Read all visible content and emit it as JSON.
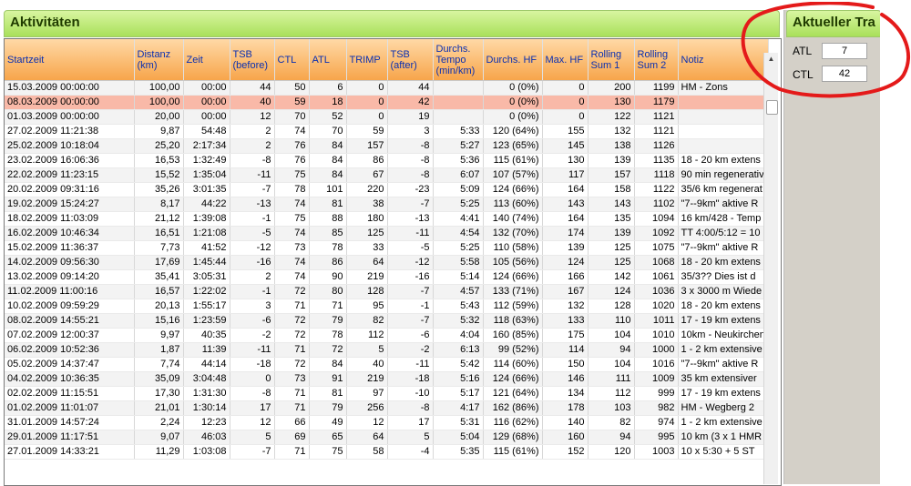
{
  "main": {
    "title": "Aktivitäten"
  },
  "side": {
    "title": "Aktueller Tra",
    "atl_label": "ATL",
    "atl_value": "7",
    "ctl_label": "CTL",
    "ctl_value": "42"
  },
  "columns": [
    "Startzeit",
    "Distanz (km)",
    "Zeit",
    "TSB (before)",
    "CTL",
    "ATL",
    "TRIMP",
    "TSB (after)",
    "Durchs. Tempo (min/km)",
    "Durchs. HF",
    "Max. HF",
    "Rolling Sum 1",
    "Rolling Sum 2",
    "Notiz"
  ],
  "rows": [
    [
      "15.03.2009 00:00:00",
      "100,00",
      "00:00",
      "44",
      "50",
      "6",
      "0",
      "44",
      "",
      "0 (0%)",
      "0",
      "200",
      "1199",
      "HM - Zons"
    ],
    [
      "08.03.2009 00:00:00",
      "100,00",
      "00:00",
      "40",
      "59",
      "18",
      "0",
      "42",
      "",
      "0 (0%)",
      "0",
      "130",
      "1179",
      ""
    ],
    [
      "01.03.2009 00:00:00",
      "20,00",
      "00:00",
      "12",
      "70",
      "52",
      "0",
      "19",
      "",
      "0 (0%)",
      "0",
      "122",
      "1121",
      ""
    ],
    [
      "27.02.2009 11:21:38",
      "9,87",
      "54:48",
      "2",
      "74",
      "70",
      "59",
      "3",
      "5:33",
      "120 (64%)",
      "155",
      "132",
      "1121",
      ""
    ],
    [
      "25.02.2009 10:18:04",
      "25,20",
      "2:17:34",
      "2",
      "76",
      "84",
      "157",
      "-8",
      "5:27",
      "123 (65%)",
      "145",
      "138",
      "1126",
      ""
    ],
    [
      "23.02.2009 16:06:36",
      "16,53",
      "1:32:49",
      "-8",
      "76",
      "84",
      "86",
      "-8",
      "5:36",
      "115 (61%)",
      "130",
      "139",
      "1135",
      "18 - 20 km extens"
    ],
    [
      "22.02.2009 11:23:15",
      "15,52",
      "1:35:04",
      "-11",
      "75",
      "84",
      "67",
      "-8",
      "6:07",
      "107 (57%)",
      "117",
      "157",
      "1118",
      "90 min regenerativ"
    ],
    [
      "20.02.2009 09:31:16",
      "35,26",
      "3:01:35",
      "-7",
      "78",
      "101",
      "220",
      "-23",
      "5:09",
      "124 (66%)",
      "164",
      "158",
      "1122",
      "35/6 km regenerat"
    ],
    [
      "19.02.2009 15:24:27",
      "8,17",
      "44:22",
      "-13",
      "74",
      "81",
      "38",
      "-7",
      "5:25",
      "113 (60%)",
      "143",
      "143",
      "1102",
      "\"7--9km\" aktive R"
    ],
    [
      "18.02.2009 11:03:09",
      "21,12",
      "1:39:08",
      "-1",
      "75",
      "88",
      "180",
      "-13",
      "4:41",
      "140 (74%)",
      "164",
      "135",
      "1094",
      "16 km/428 - Temp"
    ],
    [
      "16.02.2009 10:46:34",
      "16,51",
      "1:21:08",
      "-5",
      "74",
      "85",
      "125",
      "-11",
      "4:54",
      "132 (70%)",
      "174",
      "139",
      "1092",
      "TT 4:00/5:12 = 10"
    ],
    [
      "15.02.2009 11:36:37",
      "7,73",
      "41:52",
      "-12",
      "73",
      "78",
      "33",
      "-5",
      "5:25",
      "110 (58%)",
      "139",
      "125",
      "1075",
      "\"7--9km\" aktive R"
    ],
    [
      "14.02.2009 09:56:30",
      "17,69",
      "1:45:44",
      "-16",
      "74",
      "86",
      "64",
      "-12",
      "5:58",
      "105 (56%)",
      "124",
      "125",
      "1068",
      "18 - 20 km extens"
    ],
    [
      "13.02.2009 09:14:20",
      "35,41",
      "3:05:31",
      "2",
      "74",
      "90",
      "219",
      "-16",
      "5:14",
      "124 (66%)",
      "166",
      "142",
      "1061",
      "35/3?? Dies ist d"
    ],
    [
      "11.02.2009 11:00:16",
      "16,57",
      "1:22:02",
      "-1",
      "72",
      "80",
      "128",
      "-7",
      "4:57",
      "133 (71%)",
      "167",
      "124",
      "1036",
      "3 x 3000 m Wiede"
    ],
    [
      "10.02.2009 09:59:29",
      "20,13",
      "1:55:17",
      "3",
      "71",
      "71",
      "95",
      "-1",
      "5:43",
      "112 (59%)",
      "132",
      "128",
      "1020",
      "18 - 20 km extens"
    ],
    [
      "08.02.2009 14:55:21",
      "15,16",
      "1:23:59",
      "-6",
      "72",
      "79",
      "82",
      "-7",
      "5:32",
      "118 (63%)",
      "133",
      "110",
      "1011",
      "17 - 19 km extens"
    ],
    [
      "07.02.2009 12:00:37",
      "9,97",
      "40:35",
      "-2",
      "72",
      "78",
      "112",
      "-6",
      "4:04",
      "160 (85%)",
      "175",
      "104",
      "1010",
      "10km - Neukirchen"
    ],
    [
      "06.02.2009 10:52:36",
      "1,87",
      "11:39",
      "-11",
      "71",
      "72",
      "5",
      "-2",
      "6:13",
      "99 (52%)",
      "114",
      "94",
      "1000",
      "1 - 2 km extensive"
    ],
    [
      "05.02.2009 14:37:47",
      "7,74",
      "44:14",
      "-18",
      "72",
      "84",
      "40",
      "-11",
      "5:42",
      "114 (60%)",
      "150",
      "104",
      "1016",
      "\"7--9km\" aktive R"
    ],
    [
      "04.02.2009 10:36:35",
      "35,09",
      "3:04:48",
      "0",
      "73",
      "91",
      "219",
      "-18",
      "5:16",
      "124 (66%)",
      "146",
      "111",
      "1009",
      "35 km extensiver"
    ],
    [
      "02.02.2009 11:15:51",
      "17,30",
      "1:31:30",
      "-8",
      "71",
      "81",
      "97",
      "-10",
      "5:17",
      "121 (64%)",
      "134",
      "112",
      "999",
      "17 - 19 km extens"
    ],
    [
      "01.02.2009 11:01:07",
      "21,01",
      "1:30:14",
      "17",
      "71",
      "79",
      "256",
      "-8",
      "4:17",
      "162 (86%)",
      "178",
      "103",
      "982",
      "HM - Wegberg 2"
    ],
    [
      "31.01.2009 14:57:24",
      "2,24",
      "12:23",
      "12",
      "66",
      "49",
      "12",
      "17",
      "5:31",
      "116 (62%)",
      "140",
      "82",
      "974",
      "1 - 2 km extensive"
    ],
    [
      "29.01.2009 11:17:51",
      "9,07",
      "46:03",
      "5",
      "69",
      "65",
      "64",
      "5",
      "5:04",
      "129 (68%)",
      "160",
      "94",
      "995",
      "10 km (3 x 1 HMR"
    ],
    [
      "27.01.2009 14:33:21",
      "11,29",
      "1:03:08",
      "-7",
      "71",
      "75",
      "58",
      "-4",
      "5:35",
      "115 (61%)",
      "152",
      "120",
      "1003",
      "10 x 5:30 + 5 ST"
    ]
  ]
}
